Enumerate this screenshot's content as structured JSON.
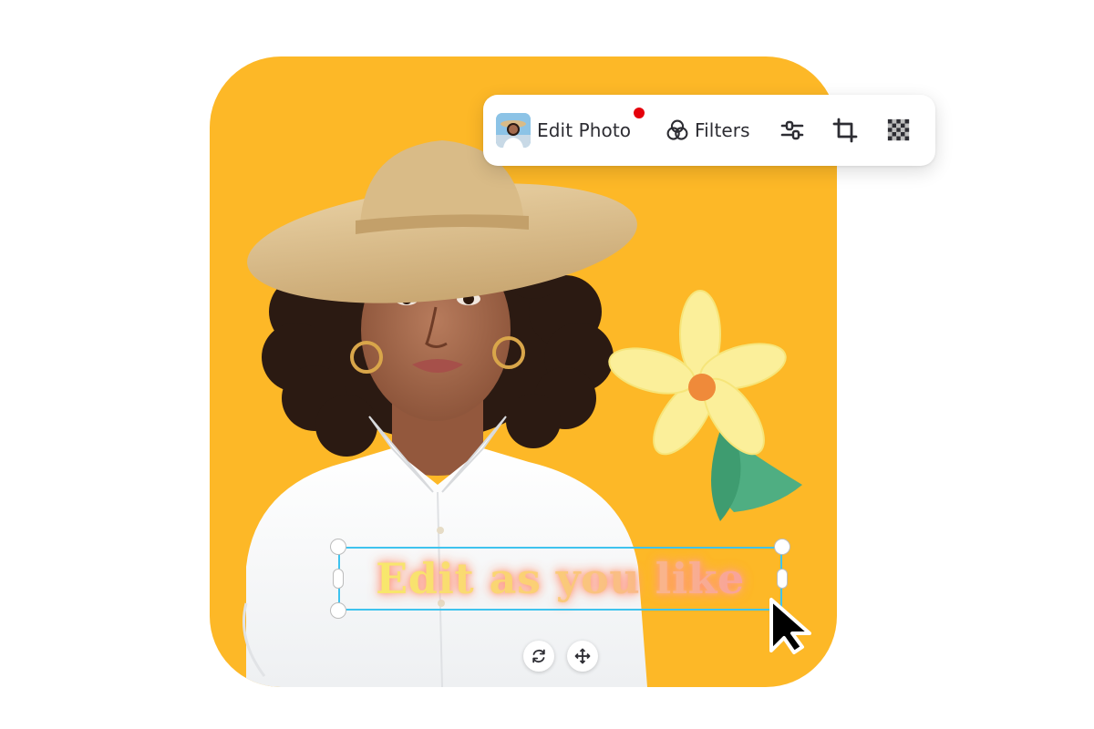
{
  "toolbar": {
    "edit_photo_label": "Edit Photo",
    "filters_label": "Filters",
    "notification_color": "#e5000b",
    "icons": [
      "photo-thumbnail",
      "filters-icon",
      "adjust-sliders-icon",
      "crop-icon",
      "transparency-icon"
    ]
  },
  "canvas": {
    "background_color": "#FDB827",
    "text_layer": "Edit as you like",
    "selection_color": "#3fc3ee"
  },
  "controls": {
    "rotate": "rotate-icon",
    "move": "move-icon"
  }
}
